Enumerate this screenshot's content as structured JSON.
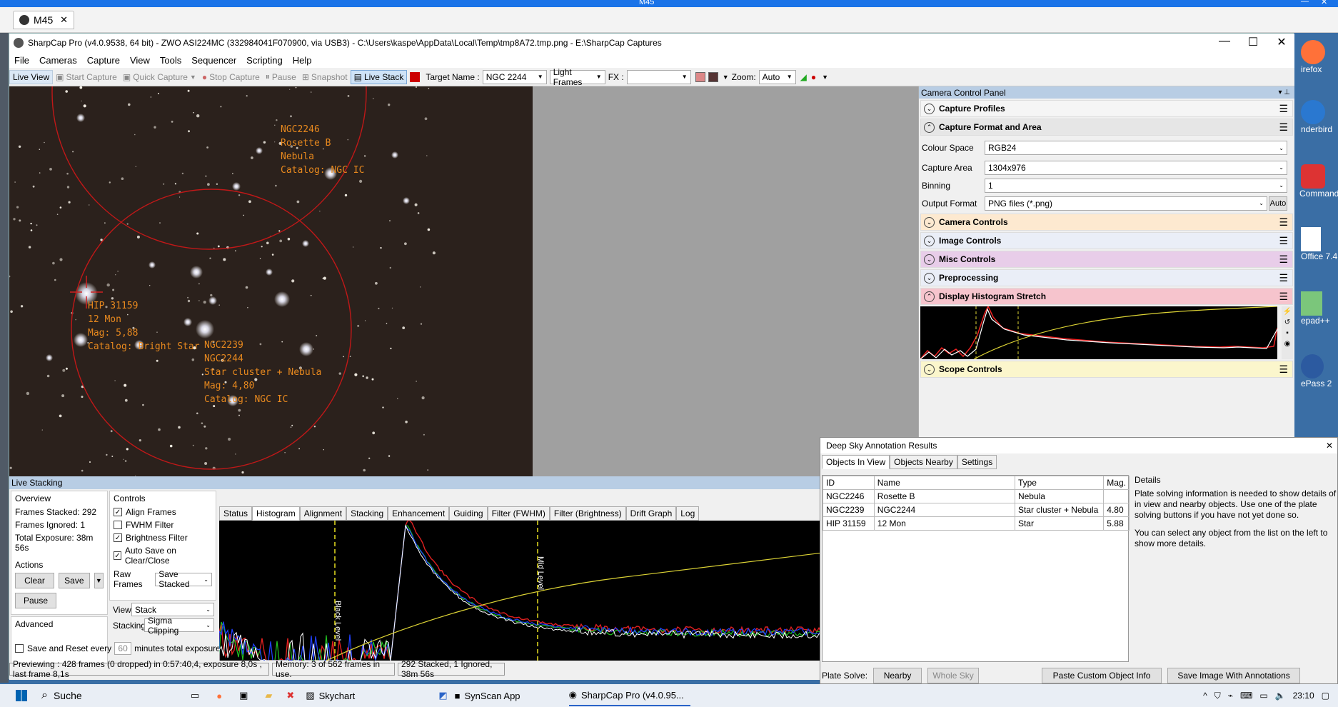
{
  "os": {
    "top_title": "M45",
    "browser_tab": "M45"
  },
  "window": {
    "title": "SharpCap Pro (v4.0.9538, 64 bit) - ZWO ASI224MC (332984041F070900, via USB3) - C:\\Users\\kaspe\\AppData\\Local\\Temp\\tmp8A72.tmp.png - E:\\SharpCap Captures",
    "menu": [
      "File",
      "Cameras",
      "Capture",
      "View",
      "Tools",
      "Sequencer",
      "Scripting",
      "Help"
    ]
  },
  "toolbar": {
    "live_view": "Live View",
    "start_capture": "Start Capture",
    "quick_capture": "Quick Capture",
    "stop_capture": "Stop Capture",
    "pause": "Pause",
    "snapshot": "Snapshot",
    "live_stack": "Live Stack",
    "target_label": "Target Name :",
    "target_value": "NGC 2244",
    "frames_type": "Light Frames",
    "fx_label": "FX :",
    "fx_value": "",
    "zoom_label": "Zoom:",
    "zoom_value": "Auto"
  },
  "image_annotations": [
    {
      "text": "NGC2246\nRosette B\nNebula\nCatalog: NGC IC"
    },
    {
      "text": "HIP 31159\n12 Mon\nMag: 5,88\nCatalog: Bright Star"
    },
    {
      "text": "NGC2239\nNGC2244\nStar cluster + Nebula\nMag: 4,80\nCatalog: NGC IC"
    }
  ],
  "camera_panel": {
    "title": "Camera Control Panel",
    "capture_profiles": "Capture Profiles",
    "capture_format": "Capture Format and Area",
    "colour_space_label": "Colour Space",
    "colour_space": "RGB24",
    "capture_area_label": "Capture Area",
    "capture_area": "1304x976",
    "binning_label": "Binning",
    "binning": "1",
    "output_format_label": "Output Format",
    "output_format": "PNG files (*.png)",
    "auto": "Auto",
    "camera_controls": "Camera Controls",
    "image_controls": "Image Controls",
    "misc_controls": "Misc Controls",
    "preprocessing": "Preprocessing",
    "display_histogram": "Display Histogram Stretch",
    "scope_controls": "Scope Controls",
    "colors": {
      "camera": "#fde9d0",
      "image": "#dde6f5",
      "misc": "#ebd2ec",
      "preprocessing": "#dde6f5",
      "histogram": "#f7c8d0",
      "scope": "#fbf6cc"
    }
  },
  "live_stacking": {
    "title": "Live Stacking",
    "overview_label": "Overview",
    "frames_stacked": "Frames Stacked: 292",
    "frames_ignored": "Frames Ignored: 1",
    "total_exposure": "Total Exposure:  38m 56s",
    "actions_label": "Actions",
    "clear": "Clear",
    "save": "Save",
    "pause": "Pause",
    "advanced_label": "Advanced",
    "save_reset": "Save and Reset every",
    "minutes_value": "60",
    "minutes_suffix": "minutes total exposure",
    "controls_label": "Controls",
    "align_frames": "Align Frames",
    "fwhm_filter": "FWHM Filter",
    "brightness_filter": "Brightness Filter",
    "auto_save": "Auto Save on Clear/Close",
    "raw_frames_label": "Raw Frames",
    "raw_frames": "Save Stacked",
    "view_label": "View",
    "view": "Stack",
    "stacking_label": "Stacking",
    "stacking": "Sigma Clipping",
    "tabs": [
      "Status",
      "Histogram",
      "Alignment",
      "Stacking",
      "Enhancement",
      "Guiding",
      "Filter (FWHM)",
      "Filter (Brightness)",
      "Drift Graph",
      "Log"
    ],
    "black_level": "Black Level",
    "mid_level": "Mid Level"
  },
  "status_bar": {
    "preview": "Previewing : 428 frames (0 dropped) in 0:57:40,4, exposure 8,0s , last frame 8,1s",
    "memory": "Memory: 3 of 562 frames in use.",
    "stacked": "292 Stacked, 1 Ignored, 38m 56s"
  },
  "dsa": {
    "title": "Deep Sky Annotation Results",
    "tabs": [
      "Objects In View",
      "Objects Nearby",
      "Settings"
    ],
    "columns": [
      "ID",
      "Name",
      "Type",
      "Mag."
    ],
    "rows": [
      [
        "NGC2246",
        "Rosette B",
        "Nebula",
        ""
      ],
      [
        "NGC2239",
        "NGC2244",
        "Star cluster + Nebula",
        "4.80"
      ],
      [
        "HIP 31159",
        "12 Mon",
        "Star",
        "5.88"
      ]
    ],
    "details_title": "Details",
    "details_p1": "Plate solving information is needed to show details of in view and nearby objects. Use one of the plate solving buttons if you have not yet done so.",
    "details_p2": "You can select any object from the list on the left to show more details.",
    "plate_solve_label": "Plate Solve:",
    "nearby": "Nearby",
    "whole_sky": "Whole Sky",
    "paste": "Paste Custom Object Info",
    "save_image": "Save Image With Annotations"
  },
  "desktop_icons": [
    "irefox",
    "nderbird",
    "Commande",
    "Office 7.4",
    "epad++",
    "ePass 2"
  ],
  "taskbar": {
    "search": "Suche",
    "skychart": "Skychart",
    "synscan": "SynScan App",
    "sharpcap": "SharpCap Pro (v4.0.95...",
    "time": "23:10"
  }
}
